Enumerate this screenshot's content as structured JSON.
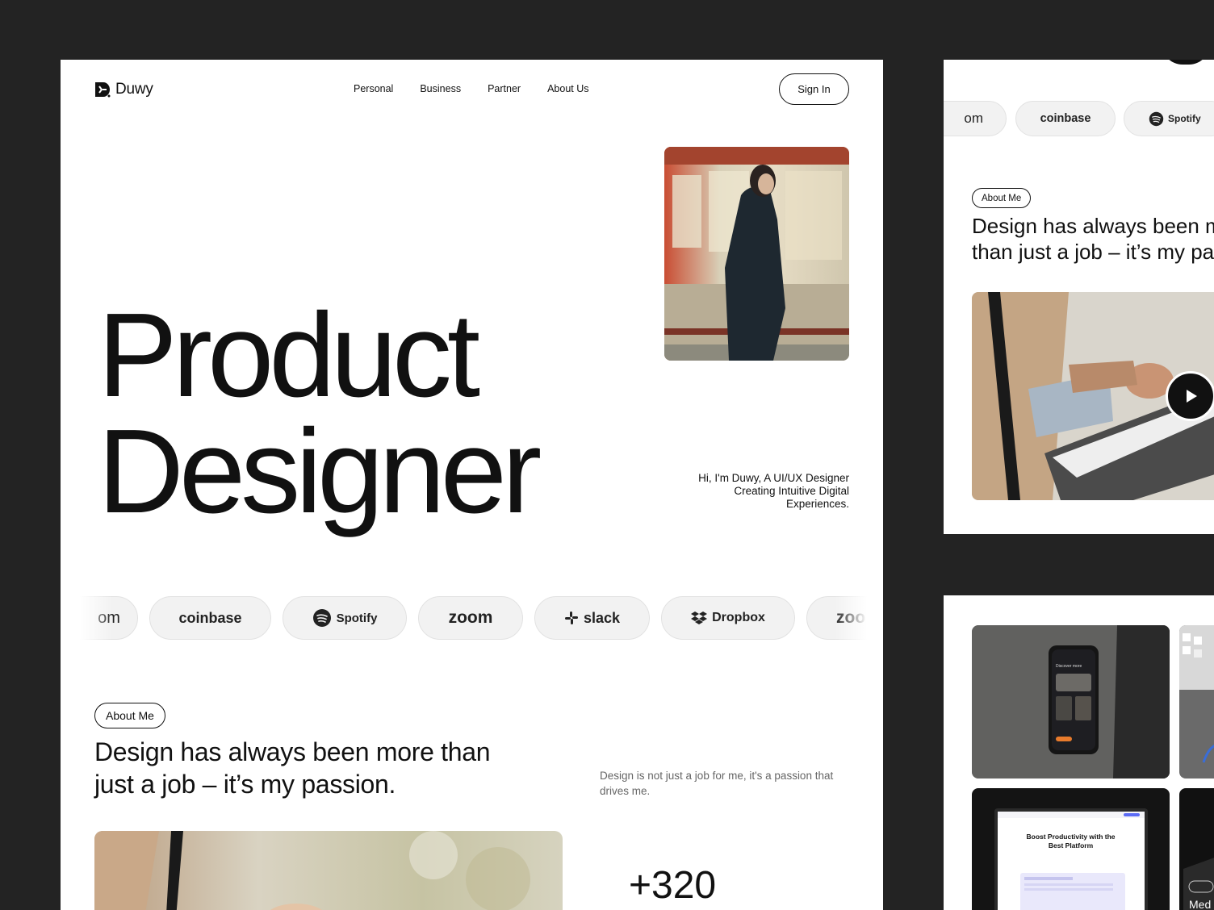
{
  "brand": {
    "name": "Duwy"
  },
  "nav": {
    "items": [
      "Personal",
      "Business",
      "Partner",
      "About Us"
    ],
    "signin": "Sign In"
  },
  "hero": {
    "title_line1": "Product",
    "title_line2": "Designer",
    "description": "Hi, I'm Duwy, A UI/UX Designer Creating Intuitive Digital Experiences."
  },
  "logos": {
    "items": [
      "om",
      "coinbase",
      "Spotify",
      "zoom",
      "slack",
      "Dropbox",
      "zoo"
    ]
  },
  "about": {
    "tag": "About Me",
    "title": "Design has always been more than just a job – it’s my passion.",
    "description": "Design is not just a job for me, it's a passion that drives me.",
    "stat": "+320"
  },
  "card2": {
    "logos": [
      "om",
      "coinbase",
      "Spotify"
    ],
    "tag": "About Me",
    "title_line1": "Design has always been m",
    "title_line2": "than just a job – it’s my pa"
  },
  "card3": {
    "mock_phone_text": "Discover more",
    "mock_laptop_title": "Boost Productivity with the Best Platform",
    "side_label": "Med"
  },
  "colors": {
    "background": "#232323",
    "card": "#ffffff",
    "pill": "#f2f2f2",
    "text": "#111111",
    "muted": "#666666"
  }
}
